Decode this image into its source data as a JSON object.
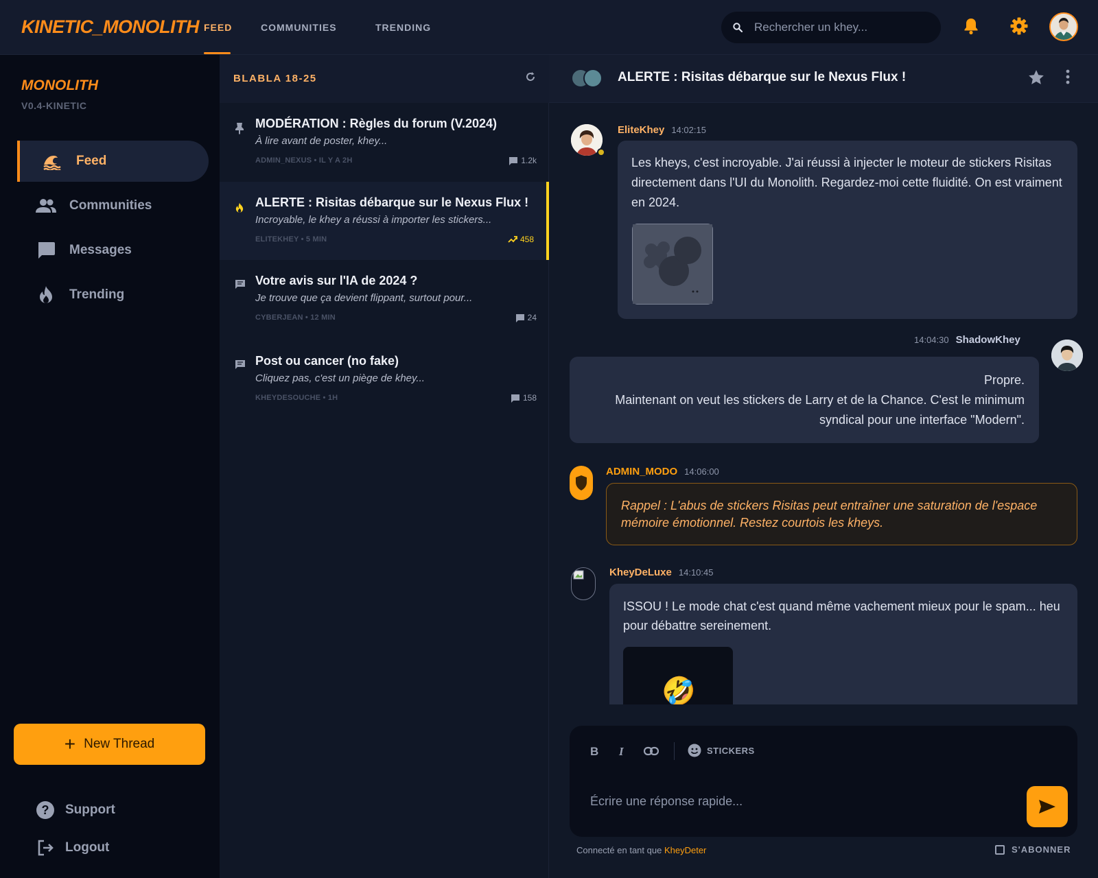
{
  "app": {
    "logo": "KINETIC_MONOLITH"
  },
  "topnav": {
    "tabs": [
      {
        "label": "FEED",
        "active": true
      },
      {
        "label": "COMMUNITIES"
      },
      {
        "label": "TRENDING"
      }
    ]
  },
  "search": {
    "placeholder": "Rechercher un khey..."
  },
  "sidebar": {
    "brand": "MONOLITH",
    "version": "V0.4-KINETIC",
    "items": [
      {
        "label": "Feed",
        "icon": "wave-icon",
        "active": true
      },
      {
        "label": "Communities",
        "icon": "group-icon"
      },
      {
        "label": "Messages",
        "icon": "chat-icon"
      },
      {
        "label": "Trending",
        "icon": "flame-icon"
      }
    ],
    "new_thread": "New Thread",
    "support": "Support",
    "logout": "Logout"
  },
  "threads": {
    "title": "BLABLA 18-25",
    "items": [
      {
        "title": "MODÉRATION : Règles du forum (V.2024)",
        "snippet": "À lire avant de poster, khey...",
        "meta": "ADMIN_NEXUS • IL Y A 2H",
        "count": "1.2k",
        "icon": "pin-icon"
      },
      {
        "title": "ALERTE : Risitas débarque sur le Nexus Flux !",
        "snippet": "Incroyable, le khey a réussi à importer les stickers...",
        "meta": "ELITEKHEY • 5 MIN",
        "count": "458",
        "icon": "flame-icon",
        "selected": true
      },
      {
        "title": "Votre avis sur l'IA de 2024 ?",
        "snippet": "Je trouve que ça devient flippant, surtout pour...",
        "meta": "CYBERJEAN • 12 MIN",
        "count": "24",
        "icon": "comment-icon"
      },
      {
        "title": "Post ou cancer (no fake)",
        "snippet": "Cliquez pas, c'est un piège de khey...",
        "meta": "KHEYDESOUCHE • 1H",
        "count": "158",
        "icon": "comment-icon"
      }
    ]
  },
  "chat": {
    "title": "ALERTE : Risitas débarque sur le Nexus Flux !",
    "messages": [
      {
        "user": "EliteKhey",
        "time": "14:02:15",
        "text": "Les kheys, c'est incroyable. J'ai réussi à injecter le moteur de stickers Risitas directement dans l'UI du Monolith. Regardez-moi cette fluidité. On est vraiment en 2024."
      },
      {
        "user": "ShadowKhey",
        "time": "14:04:30",
        "line1": "Propre.",
        "line2": "Maintenant on veut les stickers de Larry et de la Chance. C'est le minimum syndical pour une interface \"Modern\"."
      },
      {
        "user": "ADMIN_MODO",
        "time": "14:06:00",
        "text": "Rappel : L'abus de stickers Risitas peut entraîner une saturation de l'espace mémoire émotionnel. Restez courtois les kheys."
      },
      {
        "user": "KheyDeLuxe",
        "time": "14:10:45",
        "text": "ISSOU ! Le mode chat c'est quand même vachement mieux pour le spam... heu pour débattre sereinement.",
        "emoji": "🤣"
      }
    ]
  },
  "composer": {
    "bold": "B",
    "italic": "I",
    "stickers": "STICKERS",
    "placeholder": "Écrire une réponse rapide...",
    "connected_prefix": "Connecté en tant que",
    "username": "KheyDeter",
    "subscribe": "S'ABONNER"
  },
  "colors": {
    "accent": "#ff9f0f",
    "selected_bar": "#ffd21f",
    "background": "#0b1020"
  }
}
